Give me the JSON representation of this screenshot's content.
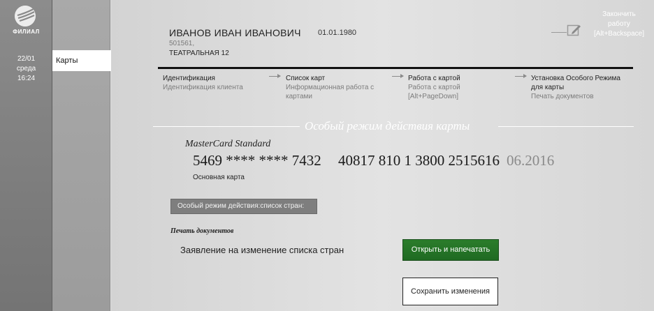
{
  "sidebar": {
    "logo_text": "ФИЛИАЛ",
    "date": "22/01",
    "weekday": "среда",
    "time": "16:24"
  },
  "menu": {
    "items": [
      {
        "label": "Карты"
      }
    ]
  },
  "client": {
    "name": "ИВАНОВ ИВАН ИВАНОВИЧ",
    "dob": "01.01.1980",
    "id": "501561,",
    "address": "ТЕАТРАЛЬНАЯ 12"
  },
  "header": {
    "finish_line1": "Закончить",
    "finish_line2": "работу",
    "finish_hotkey": "[Alt+Backspace]"
  },
  "steps": [
    {
      "title": "Идентификация",
      "sub": [
        "Идентификация клиента"
      ]
    },
    {
      "title": "Список карт",
      "sub": [
        "Информационная работа с",
        "картами"
      ]
    },
    {
      "title": "Работа с картой",
      "sub": [
        "Работа с картой",
        "[Alt+PageDown]"
      ]
    },
    {
      "title": "Установка Особого Режима",
      "title2": "для карты",
      "sub": [
        "Печать документов"
      ]
    }
  ],
  "section": {
    "title": "Особый режим действия карты"
  },
  "card": {
    "type": "MasterCard Standard",
    "number": "5469 **** **** 7432",
    "account": "40817 810 1 3800 2515616",
    "expiry": "06.2016",
    "role": "Основная карта"
  },
  "special_mode": {
    "button_label": "Особый режим действия:список стран:"
  },
  "print": {
    "label": "Печать документов",
    "document": "Заявление на изменение списка стран",
    "print_button": "Открыть и напечатать",
    "save_button": "Сохранить изменения"
  },
  "colors": {
    "accent_green": "#2b7d2b",
    "rail": "#7d7d7d"
  }
}
